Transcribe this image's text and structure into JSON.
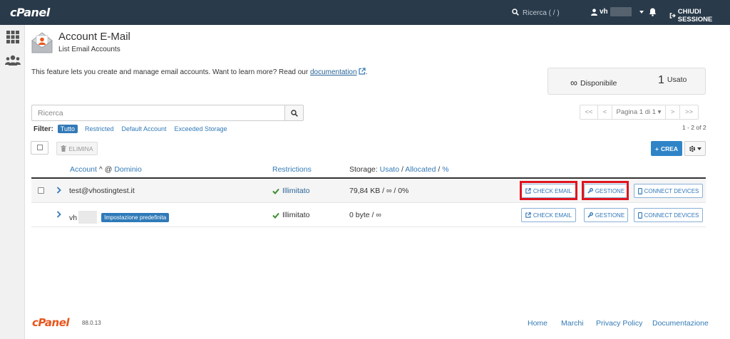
{
  "topbar": {
    "logo": "cPanel",
    "search_placeholder": "Ricerca ( / )",
    "user_prefix": "vh",
    "logout_label": "CHIUDI SESSIONE"
  },
  "header": {
    "title": "Account E-Mail",
    "subtitle": "List Email Accounts"
  },
  "intro": {
    "text": "This feature lets you create and manage email accounts. Want to learn more? Read our ",
    "link": "documentation",
    "suffix": "."
  },
  "stats": {
    "available_symbol": "∞",
    "available_label": "Disponibile",
    "used_count": "1",
    "used_label": "Usato"
  },
  "search": {
    "placeholder": "Ricerca"
  },
  "pagination": {
    "first": "<<",
    "prev": "<",
    "page_label": "Pagina 1 di 1",
    "next": ">",
    "last": ">>",
    "range": "1 - 2 of 2"
  },
  "filter": {
    "label": "Filter:",
    "options": [
      "Tutto",
      "Restricted",
      "Default Account",
      "Exceeded Storage"
    ],
    "active": "Tutto"
  },
  "toolbar": {
    "delete_label": "ELIMINA",
    "create_label": "CREA"
  },
  "table": {
    "col_account": "Account",
    "col_at": " @ ",
    "col_domain": "Dominio",
    "col_restrictions": "Restrictions",
    "col_storage_prefix": "Storage: ",
    "col_storage_used": "Usato",
    "col_storage_sep": " / ",
    "col_storage_alloc": "Allocated",
    "col_storage_pct": "%",
    "rows": [
      {
        "account": "test@vhostingtest.it",
        "restriction": "Illimitato",
        "storage": "79,84 KB / ∞ / 0%",
        "actions": [
          "CHECK EMAIL",
          "GESTIONE",
          "CONNECT DEVICES"
        ]
      },
      {
        "account": "vh",
        "badge": "Impostazione predefinita",
        "restriction": "Illimitato",
        "storage": "0 byte / ∞",
        "actions": [
          "CHECK EMAIL",
          "GESTIONE",
          "CONNECT DEVICES"
        ]
      }
    ]
  },
  "footer": {
    "logo": "cPanel",
    "version": "88.0.13",
    "links": [
      "Home",
      "Marchi",
      "Privacy Policy",
      "Documentazione"
    ]
  },
  "colors": {
    "topbar": "#293a4a",
    "accent": "#337ab7",
    "highlight": "#e0141e",
    "footer_logo": "#e9551c"
  }
}
